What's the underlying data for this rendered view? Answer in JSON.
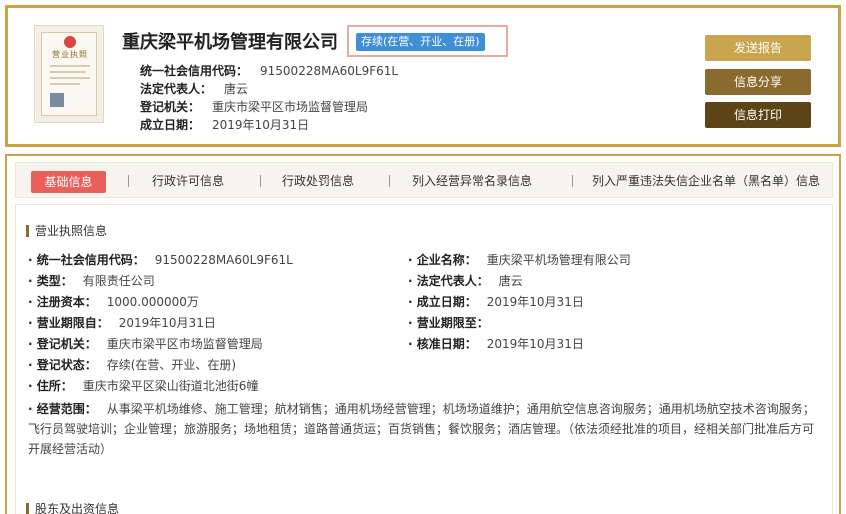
{
  "header": {
    "license_image_title": "营业执照",
    "company_name": "重庆梁平机场管理有限公司",
    "status": "存续(在营、开业、在册)",
    "rows": [
      {
        "label": "统一社会信用代码：",
        "value": "91500228MA60L9F61L"
      },
      {
        "label": "法定代表人：",
        "value": "唐云"
      },
      {
        "label": "登记机关：",
        "value": "重庆市梁平区市场监督管理局"
      },
      {
        "label": "成立日期：",
        "value": "2019年10月31日"
      }
    ],
    "buttons": {
      "send": "发送报告",
      "share": "信息分享",
      "print": "信息打印"
    }
  },
  "tabs": [
    {
      "label": "基础信息",
      "active": true
    },
    {
      "label": "行政许可信息"
    },
    {
      "label": "行政处罚信息"
    },
    {
      "label": "列入经营异常名录信息"
    },
    {
      "label": "列入严重违法失信企业名单（黑名单）信息"
    }
  ],
  "section1": {
    "title": "营业执照信息",
    "left": [
      {
        "label": "· 统一社会信用代码：",
        "value": "91500228MA60L9F61L"
      },
      {
        "label": "· 类型：",
        "value": "有限责任公司"
      },
      {
        "label": "· 注册资本：",
        "value": "1000.000000万"
      },
      {
        "label": "· 营业期限自：",
        "value": "2019年10月31日"
      },
      {
        "label": "· 登记机关：",
        "value": "重庆市梁平区市场监督管理局"
      },
      {
        "label": "· 登记状态：",
        "value": "存续(在营、开业、在册)"
      },
      {
        "label": "· 住所：",
        "value": "重庆市梁平区梁山街道北池街6幢"
      }
    ],
    "right": [
      {
        "label": "· 企业名称：",
        "value": "重庆梁平机场管理有限公司"
      },
      {
        "label": "· 法定代表人：",
        "value": "唐云"
      },
      {
        "label": "· 成立日期：",
        "value": "2019年10月31日"
      },
      {
        "label": "· 营业期限至：",
        "value": ""
      },
      {
        "label": "· 核准日期：",
        "value": "2019年10月31日"
      }
    ],
    "scope_label": "· 经营范围：",
    "scope_value": "从事梁平机场维修、施工管理；航材销售；通用机场经营管理；机场场道维护；通用航空信息咨询服务；通用机场航空技术咨询服务；飞行员驾驶培训；企业管理；旅游服务；场地租赁；道路普通货运；百货销售；餐饮服务；酒店管理。（依法须经批准的项目，经相关部门批准后方可开展经营活动）"
  },
  "section2": {
    "title": "股东及出资信息"
  }
}
